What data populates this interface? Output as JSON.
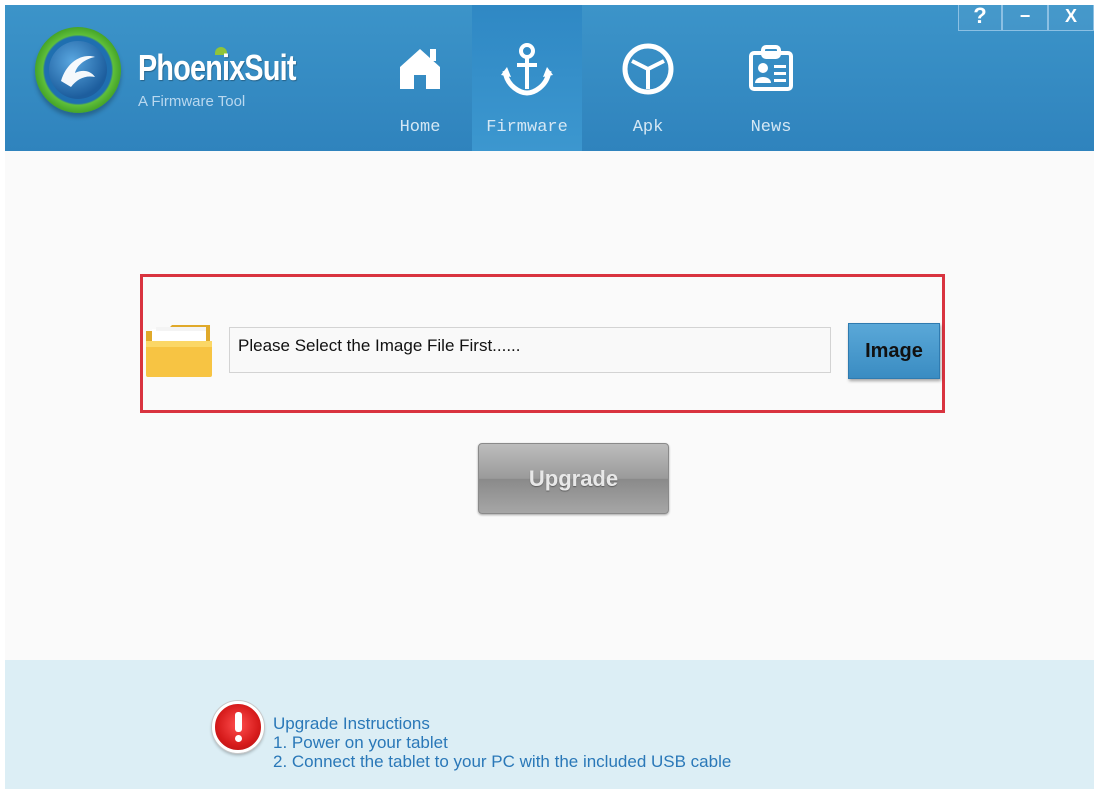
{
  "app": {
    "name": "PhoenixSuit",
    "subtitle": "A Firmware Tool"
  },
  "nav": {
    "items": [
      {
        "label": "Home",
        "icon": "home-icon"
      },
      {
        "label": "Firmware",
        "icon": "anchor-icon"
      },
      {
        "label": "Apk",
        "icon": "apk-box-icon"
      },
      {
        "label": "News",
        "icon": "news-badge-icon"
      }
    ],
    "active": "Firmware"
  },
  "window_controls": {
    "help": "?",
    "minimize": "−",
    "close": "X"
  },
  "firmware": {
    "path_value": "Please Select the Image File First......",
    "image_button": "Image",
    "upgrade_button": "Upgrade"
  },
  "footer": {
    "instructions_title": "Upgrade Instructions",
    "steps": [
      "1. Power on your tablet",
      "2. Connect the tablet to your PC with the included USB cable"
    ]
  },
  "colors": {
    "header": "#3390c6",
    "highlight_border": "#d9333f",
    "footer_bg": "#dceef5",
    "instruction_text": "#2a78b8"
  }
}
